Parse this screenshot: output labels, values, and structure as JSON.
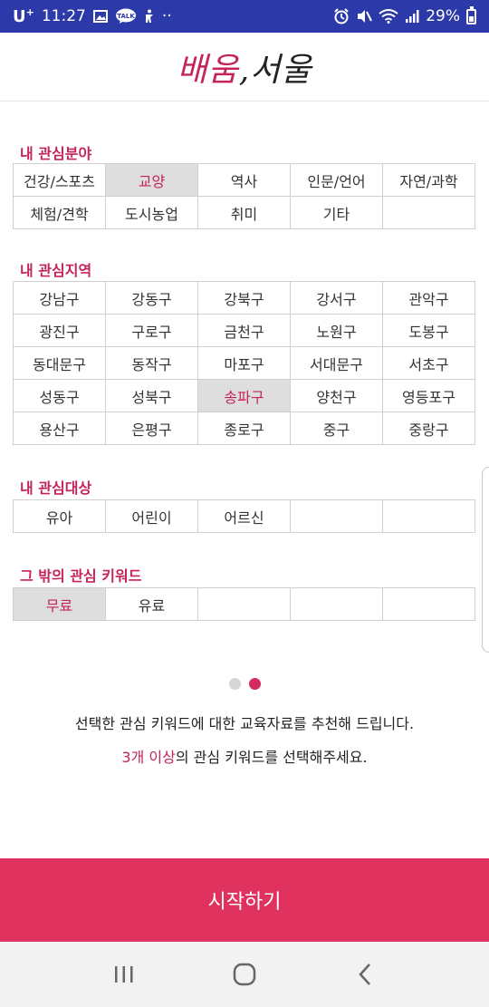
{
  "status_bar": {
    "carrier": "U",
    "carrier_sup": "+",
    "time": "11:27",
    "talk_label": "TALK",
    "more": "··",
    "battery": "29%"
  },
  "header": {
    "logo_part1": "배움",
    "logo_sep": ",",
    "logo_part2": "서울"
  },
  "sections": {
    "field": {
      "title": "내 관심분야",
      "items": [
        "건강/스포츠",
        "교양",
        "역사",
        "인문/언어",
        "자연/과학",
        "체험/견학",
        "도시농업",
        "취미",
        "기타",
        ""
      ],
      "selected": [
        1
      ]
    },
    "region": {
      "title": "내 관심지역",
      "items": [
        "강남구",
        "강동구",
        "강북구",
        "강서구",
        "관악구",
        "광진구",
        "구로구",
        "금천구",
        "노원구",
        "도봉구",
        "동대문구",
        "동작구",
        "마포구",
        "서대문구",
        "서초구",
        "성동구",
        "성북구",
        "송파구",
        "양천구",
        "영등포구",
        "용산구",
        "은평구",
        "종로구",
        "중구",
        "중랑구"
      ],
      "selected": [
        17
      ]
    },
    "target": {
      "title": "내 관심대상",
      "items": [
        "유아",
        "어린이",
        "어르신",
        "",
        ""
      ],
      "selected": []
    },
    "keyword": {
      "title": "그 밖의 관심 키워드",
      "items": [
        "무료",
        "유료",
        "",
        "",
        ""
      ],
      "selected": [
        0
      ]
    }
  },
  "pager": {
    "total": 2,
    "active": 1
  },
  "guide": {
    "line1": "선택한 관심 키워드에 대한 교육자료를 추천해 드립니다.",
    "line2_highlight": "3개 이상",
    "line2_rest": "의 관심 키워드를 선택해주세요."
  },
  "start_button": {
    "label": "시작하기"
  },
  "colors": {
    "accent": "#c5245a",
    "button": "#e0325f",
    "status_bar": "#2b3aa8"
  }
}
